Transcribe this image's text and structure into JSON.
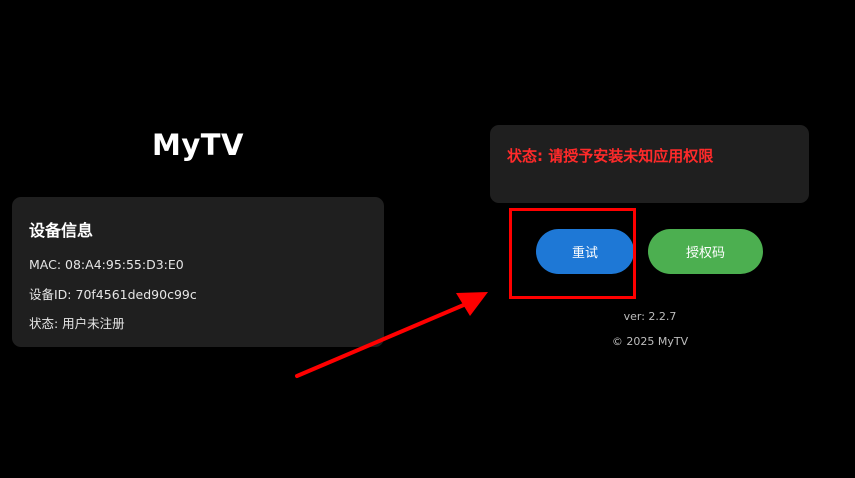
{
  "app": {
    "title": "MyTV"
  },
  "device_info": {
    "heading": "设备信息",
    "mac": "MAC: 08:A4:95:55:D3:E0",
    "device_id": "设备ID: 70f4561ded90c99c",
    "status": "状态: 用户未注册"
  },
  "status_panel": {
    "message": "状态: 请授予安装未知应用权限"
  },
  "actions": {
    "retry_label": "重试",
    "auth_code_label": "授权码"
  },
  "footer": {
    "version": "ver:  2.2.7",
    "copyright": "© 2025 MyTV"
  },
  "colors": {
    "background": "#000000",
    "card": "#1f1f1f",
    "status_error": "#ff2a2a",
    "retry_button": "#1e78d6",
    "auth_button": "#4caf50",
    "annotation": "#ff0000"
  }
}
